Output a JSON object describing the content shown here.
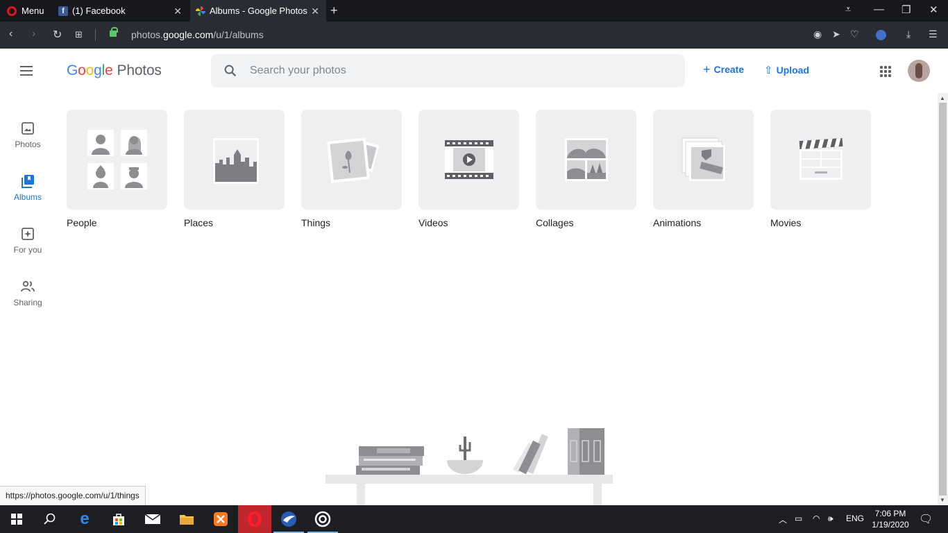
{
  "browser": {
    "menu_label": "Menu",
    "tabs": [
      {
        "label": "(1) Facebook"
      },
      {
        "label": "Albums - Google Photos"
      }
    ],
    "url_prefix": "photos.",
    "url_domain": "google.com",
    "url_path": "/u/1/albums",
    "status_url": "https://photos.google.com/u/1/things"
  },
  "header": {
    "logo_google": "Google",
    "logo_photos": "Photos",
    "search_placeholder": "Search your photos",
    "create_label": "Create",
    "upload_label": "Upload"
  },
  "sidebar": {
    "items": [
      {
        "label": "Photos",
        "icon": "photo-icon"
      },
      {
        "label": "Albums",
        "icon": "albums-icon",
        "active": true
      },
      {
        "label": "For you",
        "icon": "for-you-icon"
      },
      {
        "label": "Sharing",
        "icon": "sharing-icon"
      }
    ]
  },
  "albums": [
    {
      "label": "People"
    },
    {
      "label": "Places"
    },
    {
      "label": "Things"
    },
    {
      "label": "Videos"
    },
    {
      "label": "Collages"
    },
    {
      "label": "Animations"
    },
    {
      "label": "Movies"
    }
  ],
  "taskbar": {
    "language": "ENG",
    "time": "7:06 PM",
    "date": "1/19/2020"
  },
  "colors": {
    "accent": "#1a73e8",
    "card_bg": "#eeeff0",
    "taskbar_bg": "#1d1e22",
    "tabstrip_bg": "#17181d"
  }
}
